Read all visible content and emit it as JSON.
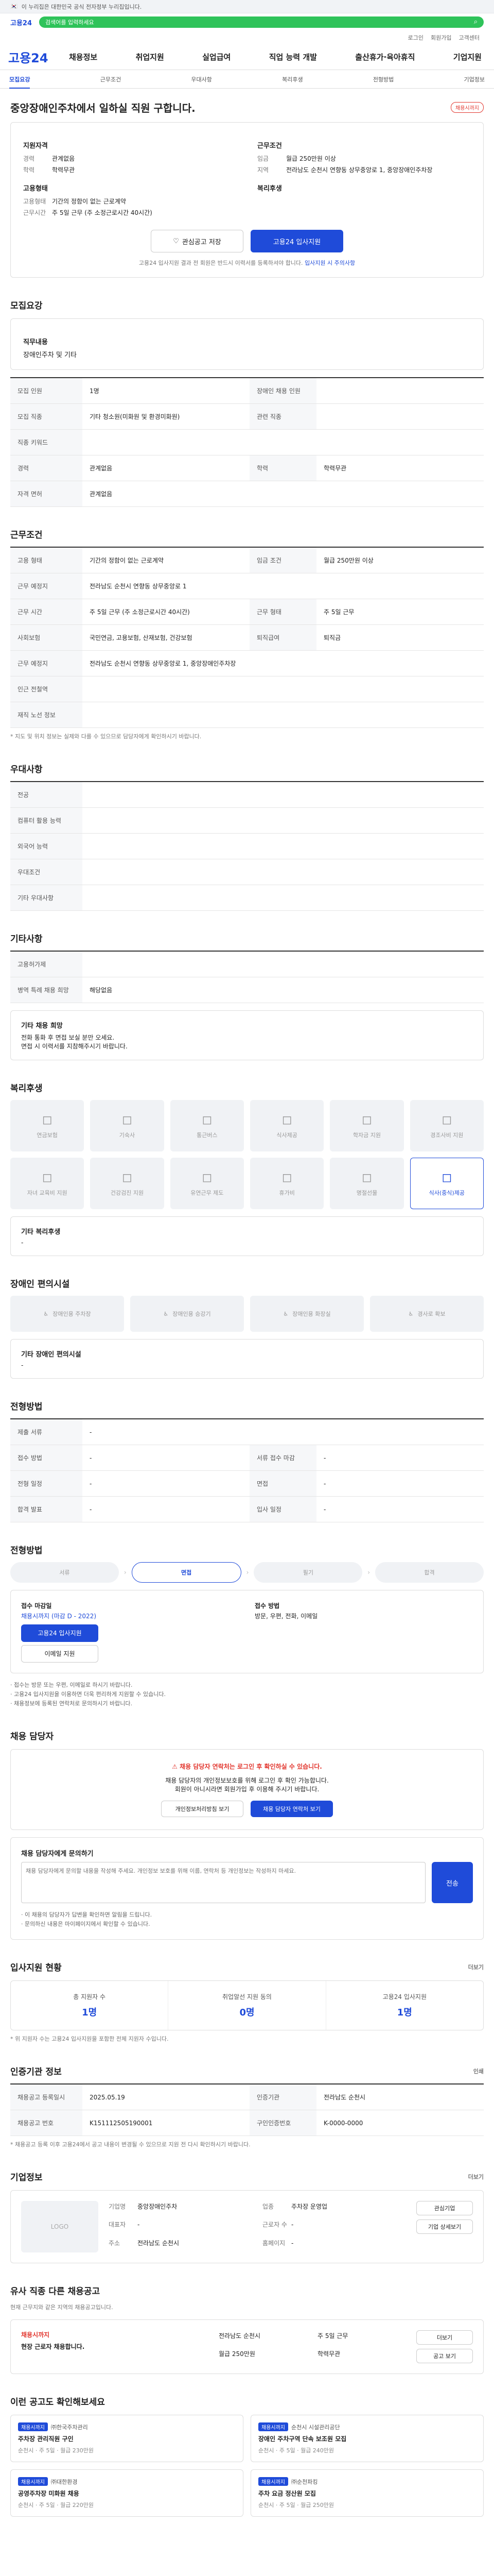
{
  "gov_banner": "이 누리집은 대한민국 공식 전자정부 누리집입니다.",
  "brand": "고용24",
  "search": {
    "placeholder": "검색어를 입력하세요"
  },
  "toplinks": [
    "로그인",
    "회원가입",
    "고객센터"
  ],
  "gnb": [
    "채용정보",
    "취업지원",
    "실업급여",
    "직업 능력 개발",
    "출산휴가·육아휴직",
    "기업지원"
  ],
  "subtabs": [
    "모집요강",
    "근무조건",
    "우대사항",
    "복리후생",
    "전형방법",
    "기업정보"
  ],
  "job": {
    "title": "중앙장애인주차에서 일하실 직원 구합니다.",
    "badge": "채용시까지",
    "recruit_label": "지원자격",
    "career_k": "경력",
    "career_v": "관계없음",
    "edu_k": "학력",
    "edu_v": "학력무관",
    "cond_label": "근무조건",
    "pay_k": "임금",
    "pay_v": "월급 250만원 이상",
    "region_k": "지역",
    "region_v": "전라남도 순천시 연향동 상무중앙로 1, 중앙장애인주차장",
    "emp_label": "고용형태",
    "emp_k": "고용형태",
    "emp_v": "기간의 정함이 없는 근로계약",
    "time_k": "근무시간",
    "time_v": "주 5일 근무 (주 소정근로시간 40시간)",
    "benefit_label": "복리후생",
    "benefit_k": "",
    "benefit_v": "",
    "btn_scrap": "관심공고 저장",
    "btn_apply": "고용24 입사지원",
    "notice": "고용24 입사지원 결과 전 회원은 반드시 이력서를 등록하셔야 합니다.",
    "notice_hl": "입사지원 시 주의사항"
  },
  "sec_recruit": {
    "title": "모집요강",
    "duty_k": "직무내용",
    "duty_v": "장애인주차 및 기타",
    "rows": [
      [
        "모집 인원",
        "1명",
        "장애인 채용 인원",
        ""
      ],
      [
        "모집 직종",
        "기타 청소원(미화원 및 환경미화원)",
        "관련 직종",
        ""
      ],
      [
        "직종 키워드",
        "",
        "",
        ""
      ],
      [
        "경력",
        "관계없음",
        "학력",
        "학력무관"
      ],
      [
        "자격 면허",
        "관계없음",
        "",
        ""
      ]
    ]
  },
  "sec_cond": {
    "title": "근무조건",
    "rows": [
      [
        "고용 형태",
        "기간의 정함이 없는 근로계약",
        "임금 조건",
        "월급 250만원 이상"
      ],
      [
        "근무 예정지",
        "전라남도 순천시 연향동 상무중앙로 1",
        "",
        ""
      ],
      [
        "근무 시간",
        "주 5일 근무 (주 소정근로시간 40시간)",
        "근무 형태",
        "주 5일 근무"
      ],
      [
        "사회보험",
        "국민연금, 고용보험, 산재보험, 건강보험",
        "퇴직급여",
        "퇴직금"
      ],
      [
        "근무 예정지",
        "전라남도 순천시 연향동 상무중앙로 1, 중앙장애인주차장",
        "",
        ""
      ],
      [
        "인근 전철역",
        "",
        "",
        ""
      ],
      [
        "재직 노선 정보",
        "",
        "",
        ""
      ]
    ],
    "note": "* 지도 및 위치 정보는 실제와 다를 수 있으므로 담당자에게 확인하시기 바랍니다.",
    "map_btn": "지도 보기"
  },
  "sec_pref": {
    "title": "우대사항",
    "rows": [
      [
        "전공",
        ""
      ],
      [
        "컴퓨터 활용 능력",
        ""
      ],
      [
        "외국어 능력",
        ""
      ],
      [
        "우대조건",
        ""
      ],
      [
        "기타 우대사항",
        ""
      ]
    ]
  },
  "sec_other": {
    "title": "기타사항",
    "rows": [
      [
        "고용허가제",
        ""
      ],
      [
        "병역 특례 채용 희망",
        "해당없음"
      ]
    ],
    "box_title": "기타 채용 희망",
    "box_lines": [
      "전화 통화 후 면접 보실 분만 오세요.",
      "면접 시 이력서를 지참해주시기 바랍니다."
    ]
  },
  "sec_benefit": {
    "title": "복리후생",
    "items": [
      "연금보험",
      "기숙사",
      "통근버스",
      "식사제공",
      "학자금 지원",
      "경조사비 지원",
      "자녀 교육비 지원",
      "건강검진 지원",
      "유연근무 제도",
      "휴가비",
      "명절선물",
      "식사(중식)제공"
    ],
    "active_index": 11,
    "extra_label": "기타 복리후생",
    "extra_value": "-"
  },
  "sec_facility": {
    "title": "장애인 편의시설",
    "items": [
      "장애인용 주차장",
      "장애인용 승강기",
      "장애인용 화장실",
      "경사로 확보"
    ],
    "extra_label": "기타 장애인 편의시설",
    "extra_value": "-"
  },
  "sec_method": {
    "title": "전형방법",
    "rows": [
      [
        "제출 서류",
        "-",
        "",
        ""
      ],
      [
        "접수 방법",
        "-",
        "서류 접수 마감",
        "-"
      ],
      [
        "전형 일정",
        "-",
        "면접",
        "-"
      ],
      [
        "합격 발표",
        "-",
        "입사 일정",
        "-"
      ]
    ],
    "steps_title": "전형방법",
    "steps": [
      "서류",
      "면접",
      "필기",
      "합격"
    ],
    "active_step": 1
  },
  "sec_apply": {
    "period_label": "접수 마감일",
    "period_value": "채용시까지 (마감 D - 2022)",
    "method_label": "접수 방법",
    "method_value": "방문, 우편, 전화, 이메일",
    "apply_btn": "고용24 입사지원",
    "email_btn": "이메일 지원",
    "bullets": [
      "· 접수는 방문 또는 우편, 이메일로 하시기 바랍니다.",
      "· 고용24 입사지원을 이용하면 더욱 편리하게 지원할 수 있습니다.",
      "· 채용정보에 등록된 연락처로 문의하시기 바랍니다."
    ]
  },
  "sec_manager": {
    "title": "채용 담당자",
    "warn": "채용 담당자 연락처는 로그인 후 확인하실 수 있습니다.",
    "lines": [
      "채용 담당자의 개인정보보호를 위해 로그인 후 확인 가능합니다.",
      "회원이 아니시라면 회원가입 후 이용해 주시기 바랍니다."
    ],
    "btn1": "개인정보처리방침 보기",
    "btn2": "채용 담당자 연락처 보기"
  },
  "sec_ask": {
    "title": "채용 담당자에게 문의하기",
    "placeholder": "채용 담당자에게 문의할 내용을 작성해 주세요. 개인정보 보호를 위해 이름, 연락처 등 개인정보는 작성하지 마세요.",
    "send": "전송",
    "notes": [
      "· 이 채용의 담당자가 답변을 확인하면 알림을 드립니다.",
      "· 문의하신 내용은 마이페이지에서 확인할 수 있습니다."
    ]
  },
  "sec_stats": {
    "title": "입사지원 현황",
    "more": "더보기",
    "items": [
      [
        "총 지원자 수",
        "1명"
      ],
      [
        "취업알선 지원 동의",
        "0명"
      ],
      [
        "고용24 입사지원",
        "1명"
      ]
    ],
    "note": "* 위 지원자 수는 고용24 입사지원을 포함한 전체 지원자 수입니다."
  },
  "sec_info": {
    "title": "인증기관 정보",
    "print": "인쇄",
    "rows": [
      [
        "채용공고 등록일시",
        "2025.05.19",
        "인증기관",
        "전라남도 순천시"
      ],
      [
        "채용공고 번호",
        "K151112505190001",
        "구인인증번호",
        "K-0000-0000"
      ]
    ],
    "note": "* 채용공고 등록 이후 고용24에서 공고 내용이 변경될 수 있으므로 지원 전 다시 확인하시기 바랍니다."
  },
  "sec_company": {
    "title": "기업정보",
    "more": "더보기",
    "logo": "LOGO",
    "info": [
      [
        "기업명",
        "중앙장애인주차"
      ],
      [
        "업종",
        "주차장 운영업"
      ],
      [
        "대표자",
        "-"
      ],
      [
        "근로자 수",
        "-"
      ],
      [
        "주소",
        "전라남도 순천시"
      ],
      [
        "홈페이지",
        "-"
      ]
    ],
    "btn1": "관심기업",
    "btn2": "기업 상세보기"
  },
  "sec_similar": {
    "title": "유사 직종 다른 채용공고",
    "desc": "현재 근무지와 같은 지역의 채용공고입니다.",
    "left_title": "채용시까지",
    "left_sub": "현장 근로자 채용합니다.",
    "items": [
      "전라남도 순천시",
      "주 5일 근무",
      "월급 250만원",
      "학력무관"
    ],
    "btns": [
      "더보기",
      "공고 보기"
    ]
  },
  "sec_recommend": {
    "title": "이런 공고도 확인해보세요",
    "cards": [
      {
        "tag": "채용시까지",
        "company": "㈜한국주차관리",
        "title": "주차장 관리직원 구인",
        "meta": "순천시 · 주 5일 · 월급 230만원"
      },
      {
        "tag": "채용시까지",
        "company": "순천시 시설관리공단",
        "title": "장애인 주차구역 단속 보조원 모집",
        "meta": "순천시 · 주 5일 · 월급 240만원"
      },
      {
        "tag": "채용시까지",
        "company": "㈜대한환경",
        "title": "공영주차장 미화원 채용",
        "meta": "순천시 · 주 5일 · 월급 220만원"
      },
      {
        "tag": "채용시까지",
        "company": "㈜순천파킹",
        "title": "주차 요금 정산원 모집",
        "meta": "순천시 · 주 5일 · 월급 250만원"
      }
    ]
  }
}
